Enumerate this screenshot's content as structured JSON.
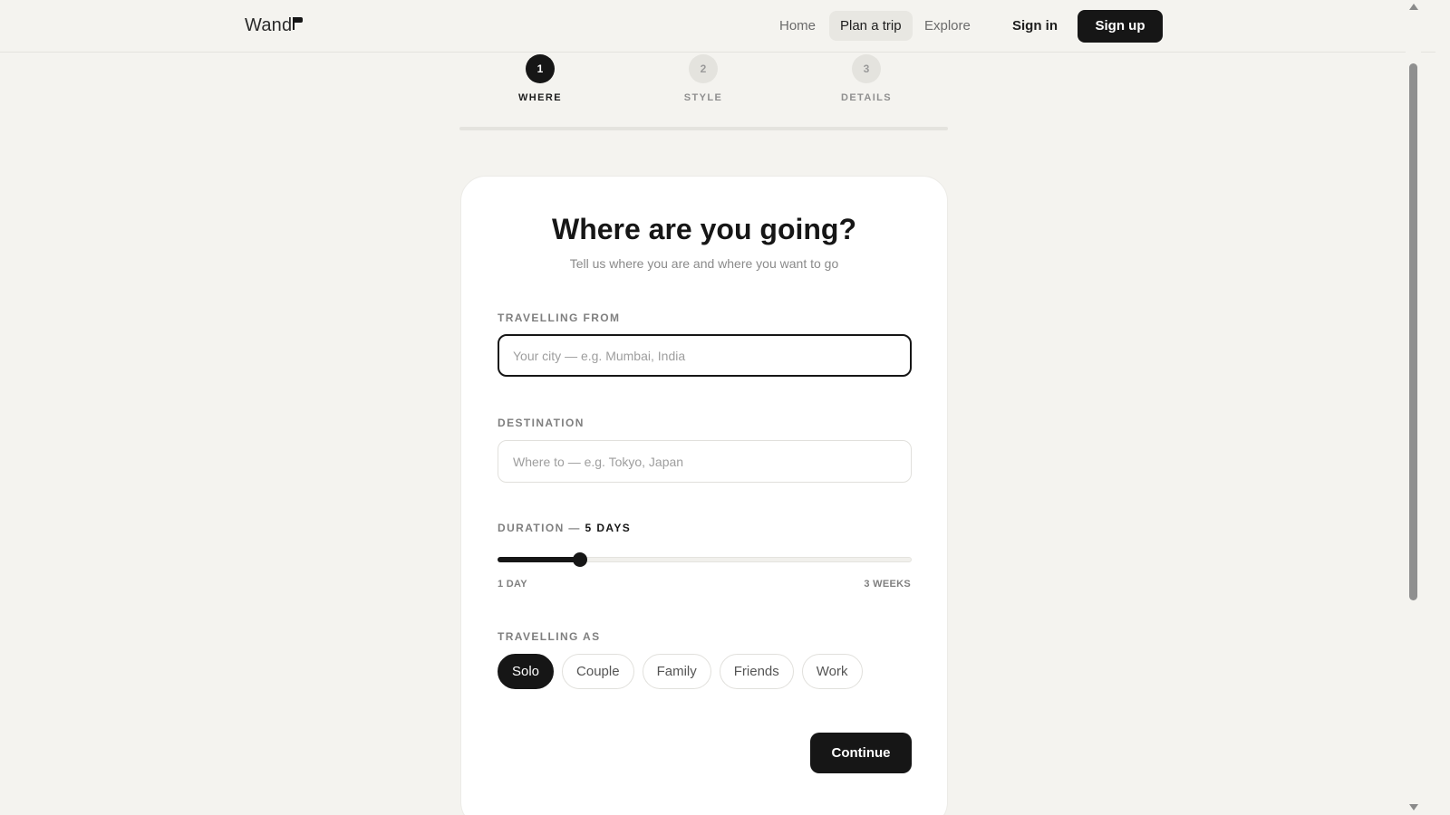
{
  "header": {
    "brand": "Wand",
    "nav": [
      {
        "label": "Home"
      },
      {
        "label": "Plan a trip",
        "active": true
      },
      {
        "label": "Explore"
      }
    ],
    "sign_in": "Sign in",
    "sign_up": "Sign up"
  },
  "stepper": {
    "steps": [
      {
        "number": "1",
        "label": "WHERE",
        "active": true
      },
      {
        "number": "2",
        "label": "STYLE",
        "active": false
      },
      {
        "number": "3",
        "label": "DETAILS",
        "active": false
      }
    ],
    "progress": 0
  },
  "form": {
    "title": "Where are you going?",
    "subtitle": "Tell us where you are and where you want to go",
    "from": {
      "label": "TRAVELLING FROM",
      "value": "",
      "placeholder": "Your city — e.g. Mumbai, India"
    },
    "destination": {
      "label": "DESTINATION",
      "value": "",
      "placeholder": "Where to — e.g. Tokyo, Japan"
    },
    "duration": {
      "label": "DURATION — ",
      "value_label": "5 DAYS",
      "value_days": 5,
      "min_days": 1,
      "max_days": 21,
      "min_label": "1 DAY",
      "max_label": "3 WEEKS"
    },
    "travelling_as": {
      "label": "TRAVELLING AS",
      "options": [
        "Solo",
        "Couple",
        "Family",
        "Friends",
        "Work"
      ],
      "selected": "Solo"
    },
    "continue_label": "Continue"
  },
  "colors": {
    "background": "#f4f3ef",
    "primary": "#161616",
    "muted": "#8a8a8a",
    "card": "#ffffff"
  }
}
